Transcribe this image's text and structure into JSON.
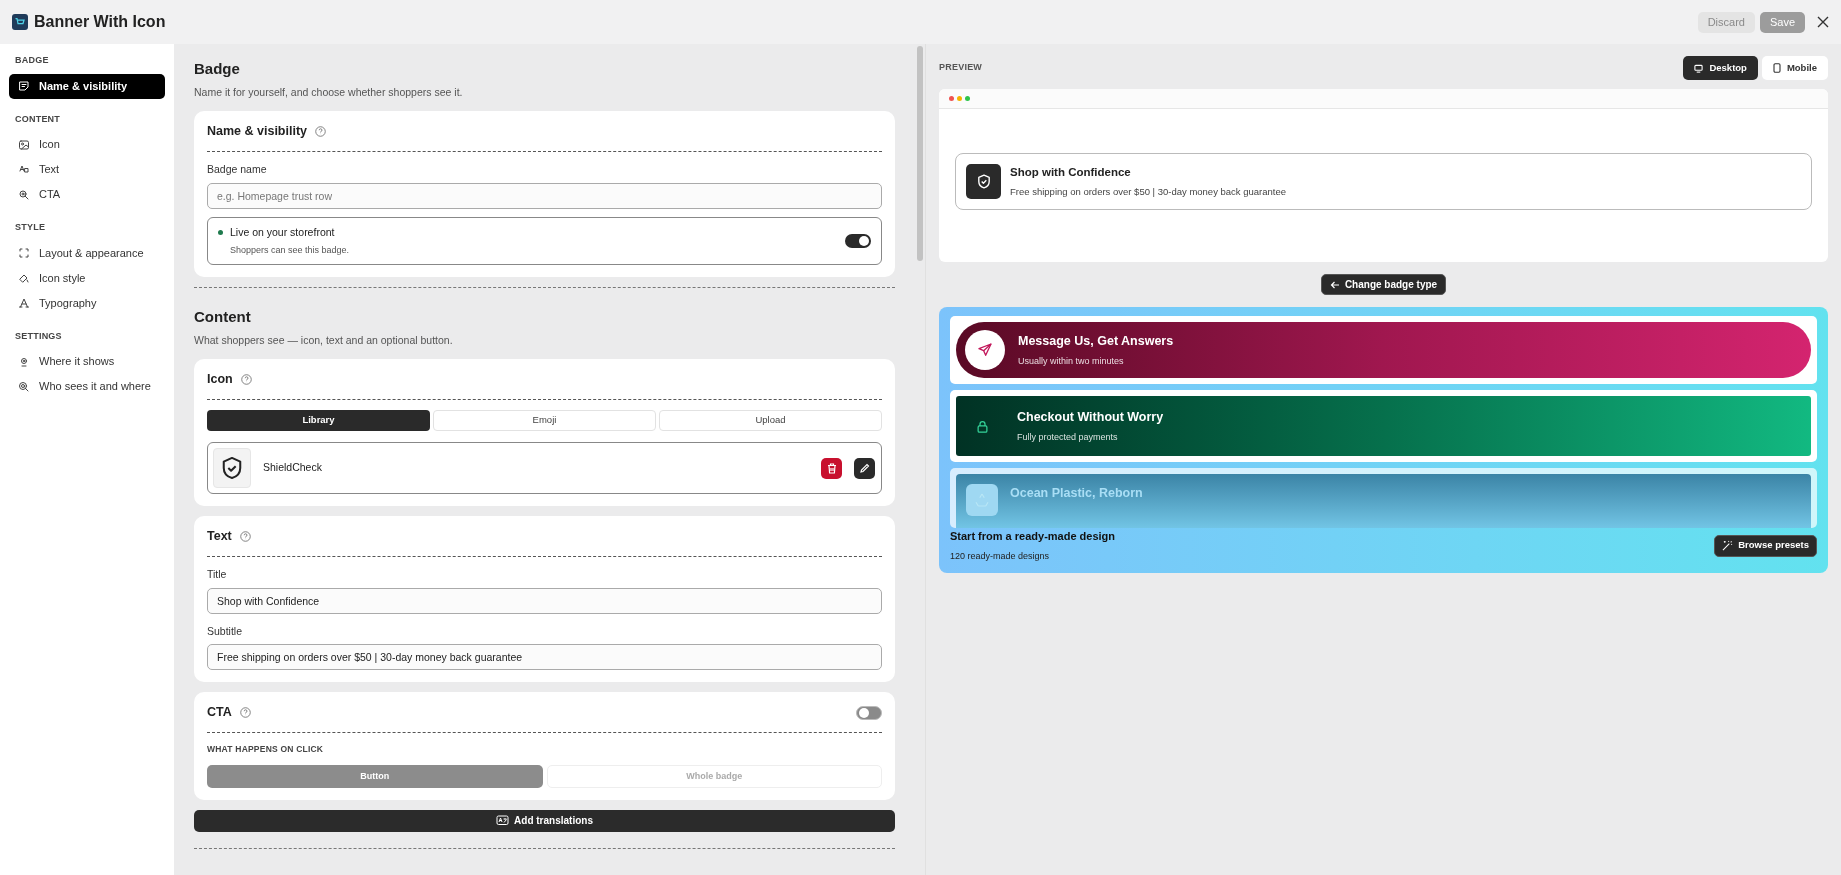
{
  "window": {
    "title": "Banner With Icon",
    "buttons": [
      {
        "label": "Discard",
        "disabled": true
      },
      {
        "label": "Save",
        "disabled": true
      }
    ]
  },
  "sidebar": {
    "sections": [
      {
        "heading": "BADGE",
        "items": [
          {
            "label": "Name & visibility",
            "selected": true
          }
        ]
      },
      {
        "heading": "CONTENT",
        "items": [
          {
            "label": "Icon",
            "selected": false
          },
          {
            "label": "Text",
            "selected": false
          },
          {
            "label": "CTA",
            "selected": false
          }
        ]
      },
      {
        "heading": "STYLE",
        "items": [
          {
            "label": "Layout & appearance",
            "selected": false
          },
          {
            "label": "Icon style",
            "selected": false
          },
          {
            "label": "Typography",
            "selected": false
          }
        ]
      },
      {
        "heading": "SETTINGS",
        "items": [
          {
            "label": "Where it shows",
            "selected": false
          },
          {
            "label": "Who sees it and where",
            "selected": false
          }
        ]
      }
    ]
  },
  "badge_section": {
    "heading": "Badge",
    "description": "Name it for yourself, and choose whether shoppers see it.",
    "card": {
      "title": "Name & visibility",
      "field": {
        "label": "Badge name",
        "placeholder": "e.g. Homepage trust row"
      },
      "live": {
        "title": "Live on your storefront",
        "subtitle": "Shoppers can see this badge.",
        "on": true
      }
    }
  },
  "content_section": {
    "heading": "Content",
    "description": "What shoppers see — icon, text and an optional button.",
    "icon_card": {
      "title": "Icon",
      "tabs": [
        {
          "label": "Library",
          "selected": true
        },
        {
          "label": "Emoji",
          "selected": false
        },
        {
          "label": "Upload",
          "selected": false
        }
      ],
      "icon_name": "ShieldCheck"
    },
    "text_card": {
      "title": "Text",
      "fields": [
        {
          "label": "Title",
          "value": "Shop with Confidence"
        },
        {
          "label": "Subtitle",
          "value": "Free shipping on orders over $50 | 30-day money back guarantee"
        }
      ]
    },
    "cta_card": {
      "title": "CTA",
      "on": false,
      "group_label": "WHAT HAPPENS ON CLICK",
      "options": [
        {
          "label": "Button",
          "selected": true
        },
        {
          "label": "Whole badge",
          "selected": false
        }
      ]
    }
  },
  "add_translations": "Add translations",
  "preview": {
    "label": "PREVIEW",
    "devices": [
      {
        "label": "Desktop",
        "selected": true
      },
      {
        "label": "Mobile",
        "selected": false
      }
    ],
    "badge": {
      "title": "Shop with Confidence",
      "subtitle": "Free shipping on orders over $50 | 30-day money back guarantee"
    },
    "change_button": "Change badge type",
    "presets": {
      "items": [
        {
          "kind": "pill",
          "title": "Message Us, Get Answers",
          "subtitle": "Usually within two minutes"
        },
        {
          "kind": "flat",
          "title": "Checkout Without Worry",
          "subtitle": "Fully protected payments"
        },
        {
          "kind": "faded",
          "title": "Ocean Plastic, Reborn"
        }
      ],
      "heading": "Start from a ready-made design",
      "count": "120 ready-made designs",
      "button": "Browse presets"
    }
  }
}
